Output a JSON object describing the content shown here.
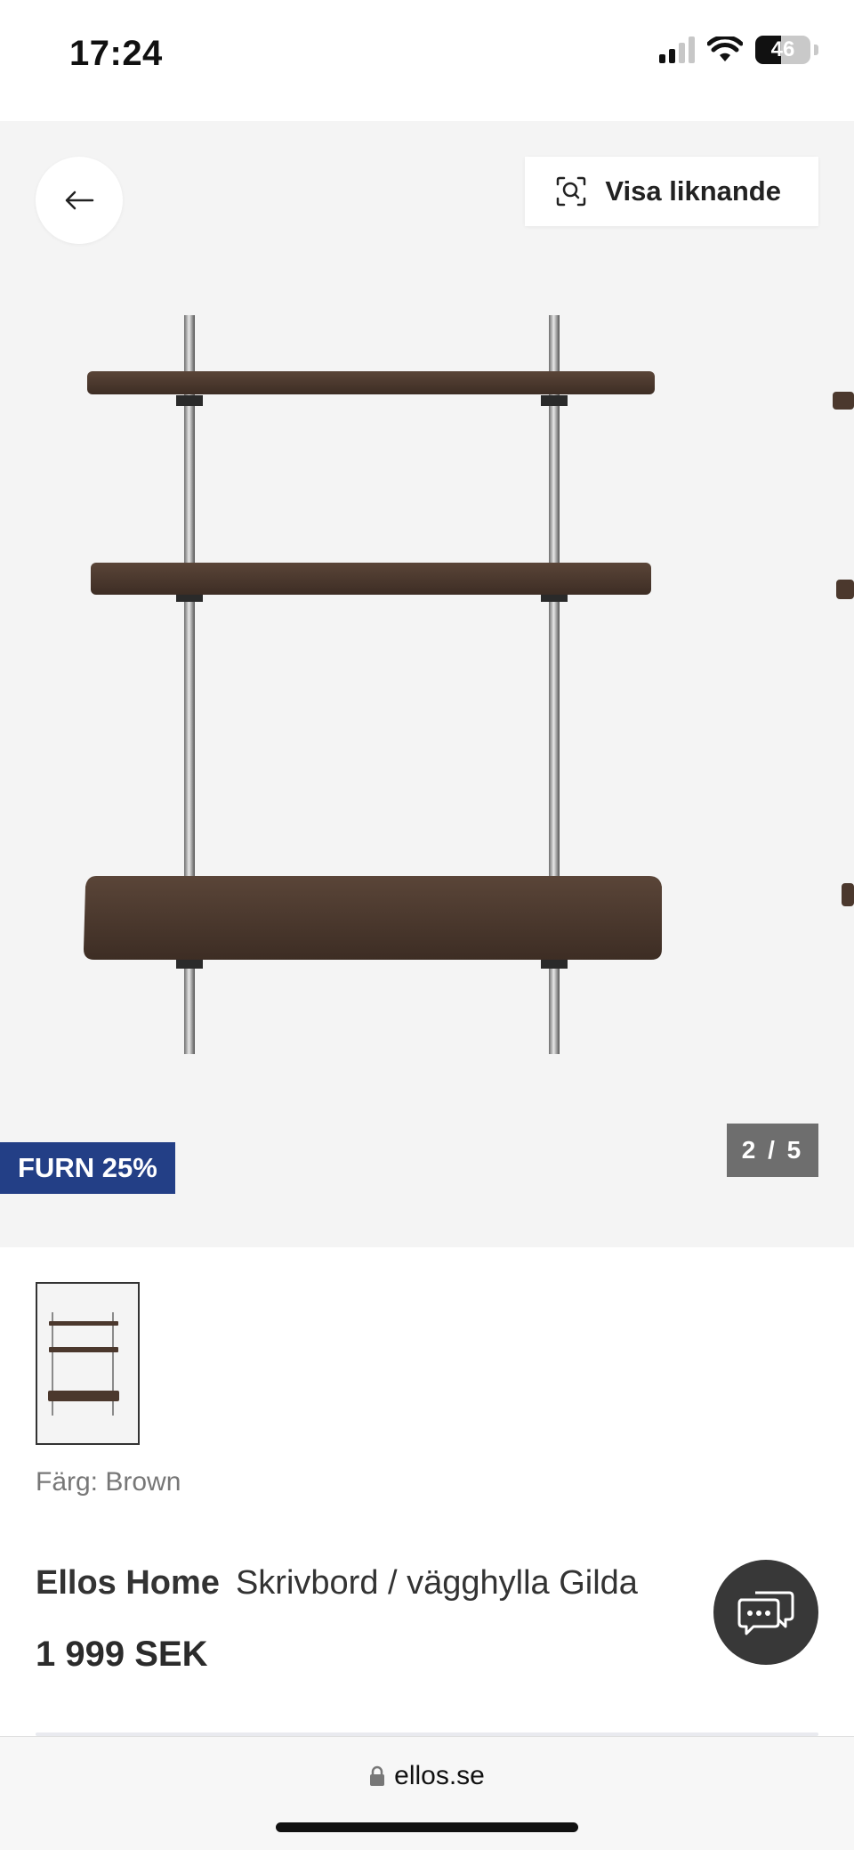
{
  "status_bar": {
    "time": "17:24",
    "battery_percent": "46",
    "icons": [
      "cellular-signal-icon",
      "wifi-icon",
      "battery-icon"
    ]
  },
  "hero": {
    "back_icon": "arrow-left-icon",
    "similar_button_label": "Visa liknande",
    "similar_icon": "visual-search-icon",
    "badge_label": "FURN 25%",
    "counter": "2 / 5",
    "badge_color": "#233f86"
  },
  "product": {
    "color_label": "Färg: Brown",
    "brand": "Ellos Home",
    "name": "Skrivbord / vägghylla Gilda",
    "price": "1 999 SEK"
  },
  "chat": {
    "icon": "chat-bubbles-icon"
  },
  "browser": {
    "url": "ellos.se",
    "lock_icon": "lock-icon"
  }
}
